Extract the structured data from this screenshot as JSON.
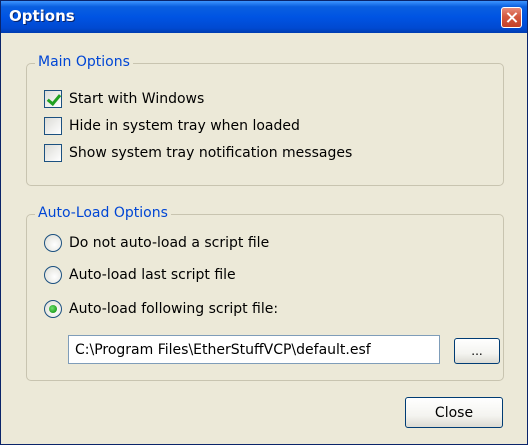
{
  "window": {
    "title": "Options"
  },
  "main_options": {
    "legend": "Main Options",
    "items": [
      {
        "label": "Start with Windows",
        "checked": true
      },
      {
        "label": "Hide in system tray when loaded",
        "checked": false
      },
      {
        "label": "Show system tray notification messages",
        "checked": false
      }
    ]
  },
  "auto_load": {
    "legend": "Auto-Load Options",
    "options": [
      {
        "label": "Do not auto-load a script file",
        "selected": false
      },
      {
        "label": "Auto-load last script file",
        "selected": false
      },
      {
        "label": "Auto-load following script file:",
        "selected": true
      }
    ],
    "script_path": "C:\\Program Files\\EtherStuffVCP\\default.esf",
    "browse_label": "..."
  },
  "footer": {
    "close_label": "Close"
  },
  "colors": {
    "titlebar": "#0054e3",
    "legend_text": "#0046d5",
    "dialog_bg": "#ece9d8",
    "check_green": "#21a121"
  }
}
